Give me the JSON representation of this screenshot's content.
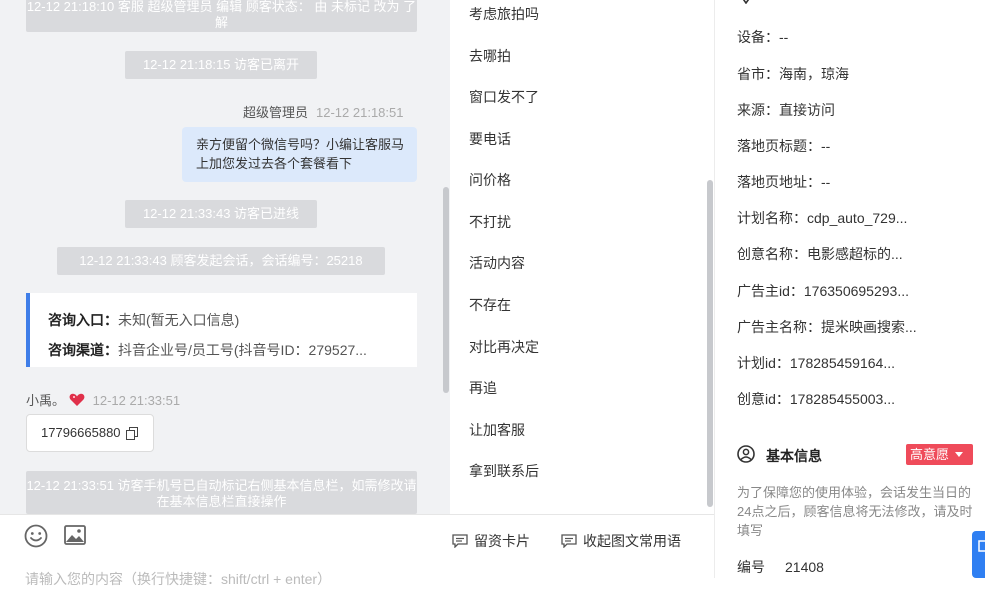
{
  "chat": {
    "sys_top": "12-12 21:18:10 客服 超级管理员 编辑 顾客状态： 由 未标记 改为 了解",
    "sys_left1": "12-12 21:18:15 访客已离开",
    "agent_name": "超级管理员",
    "agent_time": "12-12 21:18:51",
    "agent_message": "亲方便留个微信号吗？小编让客服马上加您发过去各个套餐看下",
    "sys_enter": "12-12 21:33:43 访客已进线",
    "sys_session": "12-12 21:33:43 顾客发起会话，会话编号：25218",
    "card": {
      "entry_label": "咨询入口：",
      "entry_value": "未知(暂无入口信息)",
      "channel_label": "咨询渠道：",
      "channel_value": "抖音企业号/员工号(抖音号ID：279527..."
    },
    "visitor_name": "小禹。",
    "visitor_time": "12-12 21:33:51",
    "visitor_phone": "17796665880",
    "sys_phone_note": "12-12 21:33:51 访客手机号已自动标记右侧基本信息栏，如需修改请在基本信息栏直接操作"
  },
  "input": {
    "placeholder": "请输入您的内容（换行快捷键：shift/ctrl + enter）",
    "card_button": "留资卡片",
    "phrases_button": "收起图文常用语"
  },
  "quick_replies": [
    "考虑旅拍吗",
    "去哪拍",
    "窗口发不了",
    "要电话",
    "问价格",
    "不打扰",
    "活动内容",
    "不存在",
    "对比再决定",
    "再追",
    "让加客服",
    "拿到联系后"
  ],
  "visitor_info": {
    "device": "设备：--",
    "region": "省市：海南，琼海",
    "source": "来源：直接访问",
    "landing_title": "落地页标题：--",
    "landing_url": "落地页地址：--",
    "plan_name": "计划名称：cdp_auto_729...",
    "creative_name": "创意名称：电影感超标的...",
    "advertiser_id": "广告主id：176350695293...",
    "advertiser_name": "广告主名称：提米映画搜索...",
    "plan_id": "计划id：178285459164...",
    "creative_id": "创意id：178285455003..."
  },
  "basic_info": {
    "title": "基本信息",
    "intent_tag": "高意愿",
    "tip": "为了保障您的使用体验，会话发生当日的24点之后，顾客信息将无法修改，请及时填写",
    "number_label": "编号",
    "number_value": "21408"
  },
  "colors": {
    "accent": "#3f7ee8",
    "tag_red": "#ef4b5a",
    "bubble": "#dce9fb",
    "system": "#d9dadd"
  }
}
